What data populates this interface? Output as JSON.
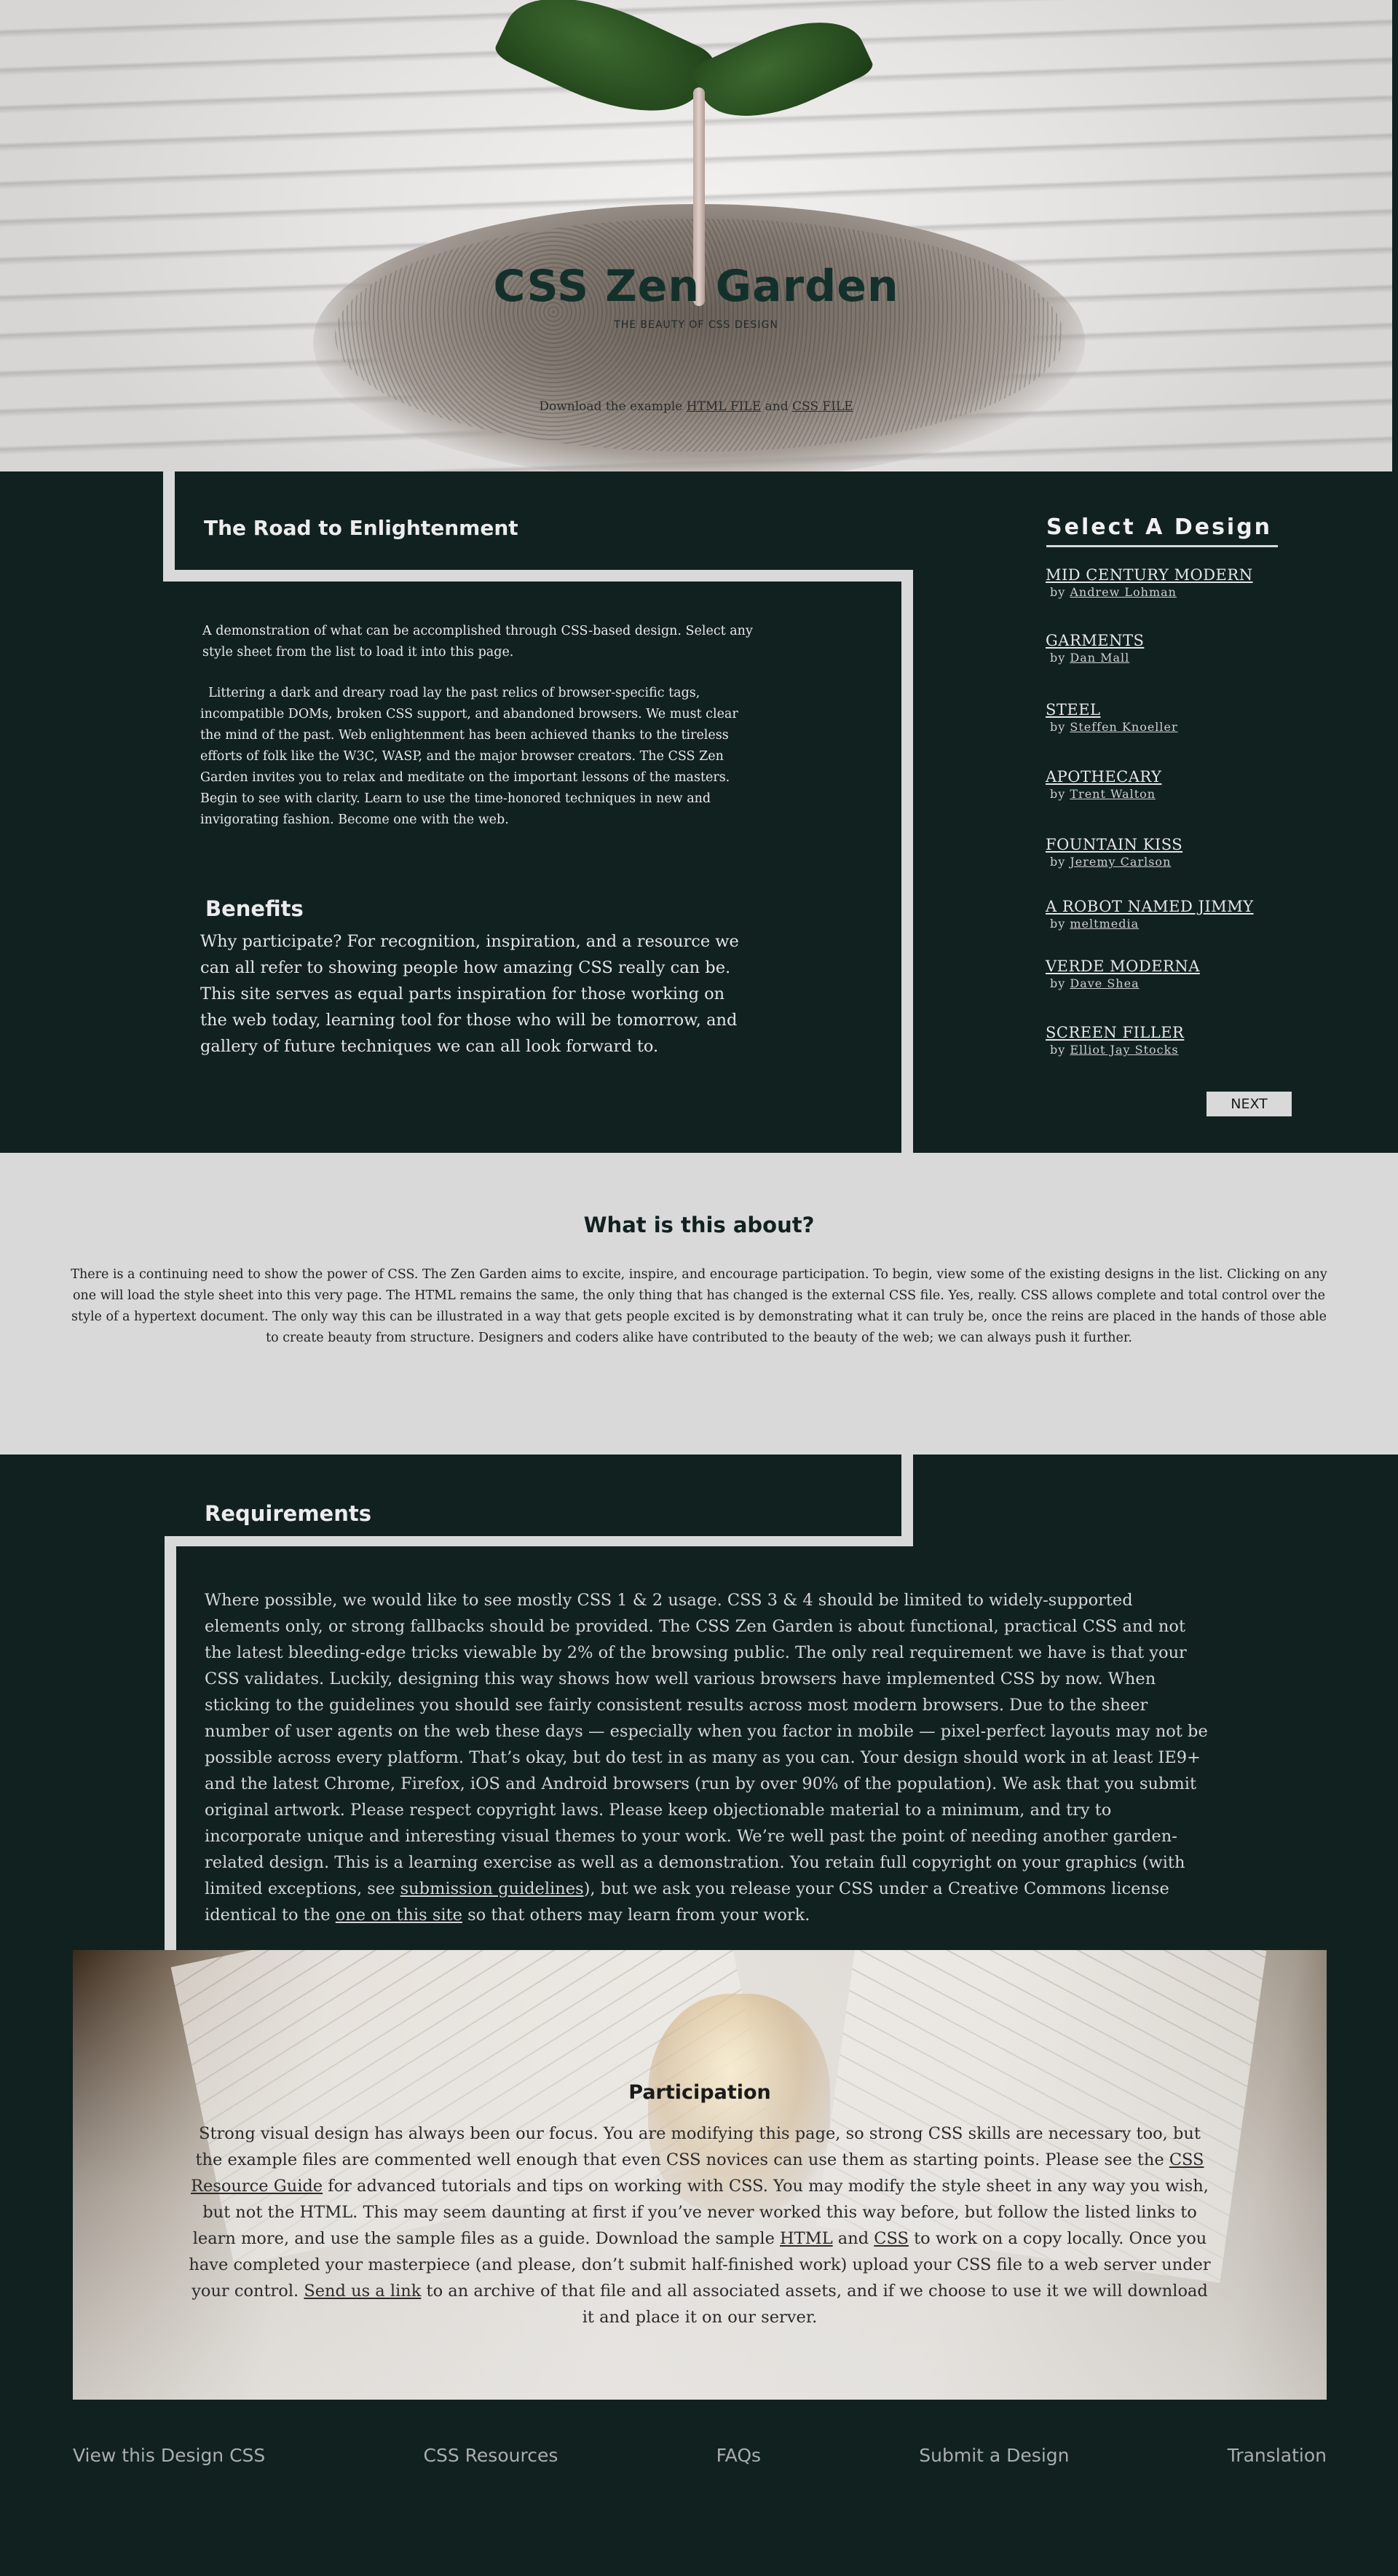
{
  "header": {
    "title": "CSS Zen Garden",
    "subtitle": "THE BEAUTY OF CSS DESIGN",
    "download_prefix": "Download the example ",
    "html_file": "HTML FILE",
    "and": " and ",
    "css_file": "CSS FILE"
  },
  "preamble": {
    "title": "The Road to Enlightenment",
    "p1": "A demonstration of what can be accomplished through CSS-based design. Select any style sheet from the list to load it into this page.",
    "p2": "Littering a dark and dreary road lay the past relics of browser-specific tags, incompatible DOMs, broken CSS support, and abandoned browsers. We must clear the mind of the past. Web enlightenment has been achieved thanks to the tireless efforts of folk like the W3C, WASP, and the major browser creators. The CSS Zen Garden invites you to relax and meditate on the important lessons of the masters. Begin to see with clarity. Learn to use the time-honored techniques in new and invigorating fashion. Become one with the web.",
    "benefits_title": "Benefits",
    "benefits_text": "Why participate? For recognition, inspiration, and a resource we can all refer to showing people how amazing CSS really can be. This site serves as equal parts inspiration for those working on the web today, learning tool for those who will be tomorrow, and gallery of future techniques we can all look forward to."
  },
  "sidebar": {
    "title": "Select A Design",
    "by": "by ",
    "designs": [
      {
        "name": "MID CENTURY MODERN",
        "author": "Andrew Lohman"
      },
      {
        "name": "GARMENTS",
        "author": "Dan Mall"
      },
      {
        "name": "STEEL",
        "author": "Steffen Knoeller"
      },
      {
        "name": "APOTHECARY",
        "author": "Trent Walton"
      },
      {
        "name": "FOUNTAIN KISS",
        "author": "Jeremy Carlson"
      },
      {
        "name": "A ROBOT NAMED JIMMY",
        "author": "meltmedia"
      },
      {
        "name": "VERDE MODERNA",
        "author": "Dave Shea"
      },
      {
        "name": "SCREEN FILLER",
        "author": "Elliot Jay Stocks"
      }
    ],
    "next_label": "NEXT"
  },
  "explanation": {
    "title": "What is this about?",
    "text": "There is a continuing need to show the power of CSS. The Zen Garden aims to excite, inspire, and encourage participation. To begin, view some of the existing designs in the list. Clicking on any one will load the style sheet into this very page. The HTML remains the same, the only thing that has changed is the external CSS file. Yes, really. CSS allows complete and total control over the style of a hypertext document. The only way this can be illustrated in a way that gets people excited is by demonstrating what it can truly be, once the reins are placed in the hands of those able to create beauty from structure. Designers and coders alike have contributed to the beauty of the web; we can always push it further."
  },
  "requirements": {
    "title": "Requirements",
    "text_before": "Where possible, we would like to see mostly CSS 1 & 2 usage. CSS 3 & 4 should be limited to widely-supported elements only, or strong fallbacks should be provided. The CSS Zen Garden is about functional, practical CSS and not the latest bleeding-edge tricks viewable by 2% of the browsing public. The only real requirement we have is that your CSS validates. Luckily, designing this way shows how well various browsers have implemented CSS by now. When sticking to the guidelines you should see fairly consistent results across most modern browsers. Due to the sheer number of user agents on the web these days — especially when you factor in mobile — pixel-perfect layouts may not be possible across every platform. That’s okay, but do test in as many as you can. Your design should work in at least IE9+ and the latest Chrome, Firefox, iOS and Android browsers (run by over 90% of the population). We ask that you submit original artwork. Please respect copyright laws. Please keep objectionable material to a minimum, and try to incorporate unique and interesting visual themes to your work. We’re well past the point of needing another garden-related design. This is a learning exercise as well as a demonstration. You retain full copyright on your graphics (with limited exceptions, see ",
    "link1": "submission guidelines",
    "text_mid": "), but we ask you release your CSS under a Creative Commons license identical to the ",
    "link2": "one on this site",
    "text_after": " so that others may learn from your work."
  },
  "participation": {
    "title": "Participation",
    "t1": "Strong visual design has always been our focus. You are modifying this page, so strong CSS skills are necessary too, but the example files are commented well enough that even CSS novices can use them as starting points. Please see the ",
    "link_guide": "CSS Resource Guide",
    "t2": " for advanced tutorials and tips on working with CSS. You may modify the style sheet in any way you wish, but not the HTML. This may seem daunting at first if you’ve never worked this way before, but follow the listed links to learn more, and use the sample files as a guide. Download the sample ",
    "link_html": "HTML",
    "t3": " and ",
    "link_css": "CSS",
    "t4": " to work on a copy locally. Once you have completed your masterpiece (and please, don’t submit half-finished work) upload your CSS file to a web server under your control. ",
    "link_send": "Send us a link",
    "t5": " to an archive of that file and all associated assets, and if we choose to use it we will download it and place it on our server."
  },
  "footer": {
    "links": [
      "View this Design CSS",
      "CSS Resources",
      "FAQs",
      "Submit a Design",
      "Translation"
    ]
  }
}
